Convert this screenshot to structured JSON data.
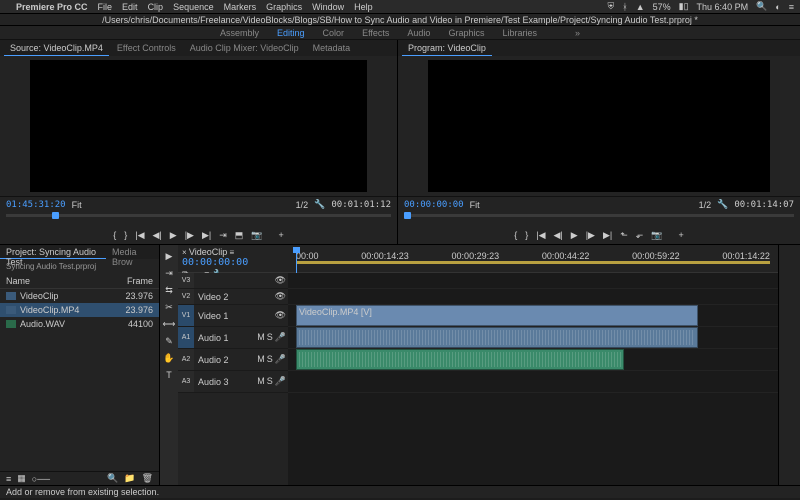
{
  "menubar": {
    "app": "Premiere Pro CC",
    "items": [
      "File",
      "Edit",
      "Clip",
      "Sequence",
      "Markers",
      "Graphics",
      "Window",
      "Help"
    ],
    "battery": "57%",
    "time": "Thu 6:40 PM"
  },
  "pathbar": "/Users/chris/Documents/Freelance/VideoBlocks/Blogs/SB/How to Sync Audio and Video in Premiere/Test Example/Project/Syncing Audio Test.prproj *",
  "workspaces": {
    "items": [
      "Assembly",
      "Editing",
      "Color",
      "Effects",
      "Audio",
      "Graphics",
      "Libraries"
    ],
    "active": "Editing"
  },
  "source": {
    "tabs": [
      "Source: VideoClip.MP4",
      "Effect Controls",
      "Audio Clip Mixer: VideoClip",
      "Metadata"
    ],
    "tc_in": "01:45:31:20",
    "fit": "Fit",
    "ratio": "1/2",
    "tc_out": "00:01:01:12"
  },
  "program": {
    "title": "Program: VideoClip",
    "tc_in": "00:00:00:00",
    "fit": "Fit",
    "ratio": "1/2",
    "tc_out": "00:01:14:07"
  },
  "project": {
    "tabs": [
      "Project: Syncing Audio Test",
      "Media Brow"
    ],
    "name": "Syncing Audio Test.prproj",
    "cols": {
      "name": "Name",
      "frame": "Frame"
    },
    "items": [
      {
        "name": "VideoClip",
        "frame": "23.976",
        "type": "seq"
      },
      {
        "name": "VideoClip.MP4",
        "frame": "23.976",
        "type": "vid",
        "sel": true
      },
      {
        "name": "Audio.WAV",
        "frame": "44100",
        "type": "aud"
      }
    ]
  },
  "timeline": {
    "seq": "VideoClip",
    "tc": "00:00:00:00",
    "ruler": [
      "00:00",
      "00:00:14:23",
      "00:00:29:23",
      "00:00:44:22",
      "00:00:59:22",
      "00:01:14:22"
    ],
    "tracks": {
      "v3": "",
      "v2": "Video 2",
      "v1": "Video 1",
      "a1": "Audio 1",
      "a2": "Audio 2",
      "a3": "Audio 3"
    },
    "clip_label": "VideoClip.MP4 [V]"
  },
  "status": "Add or remove from existing selection."
}
